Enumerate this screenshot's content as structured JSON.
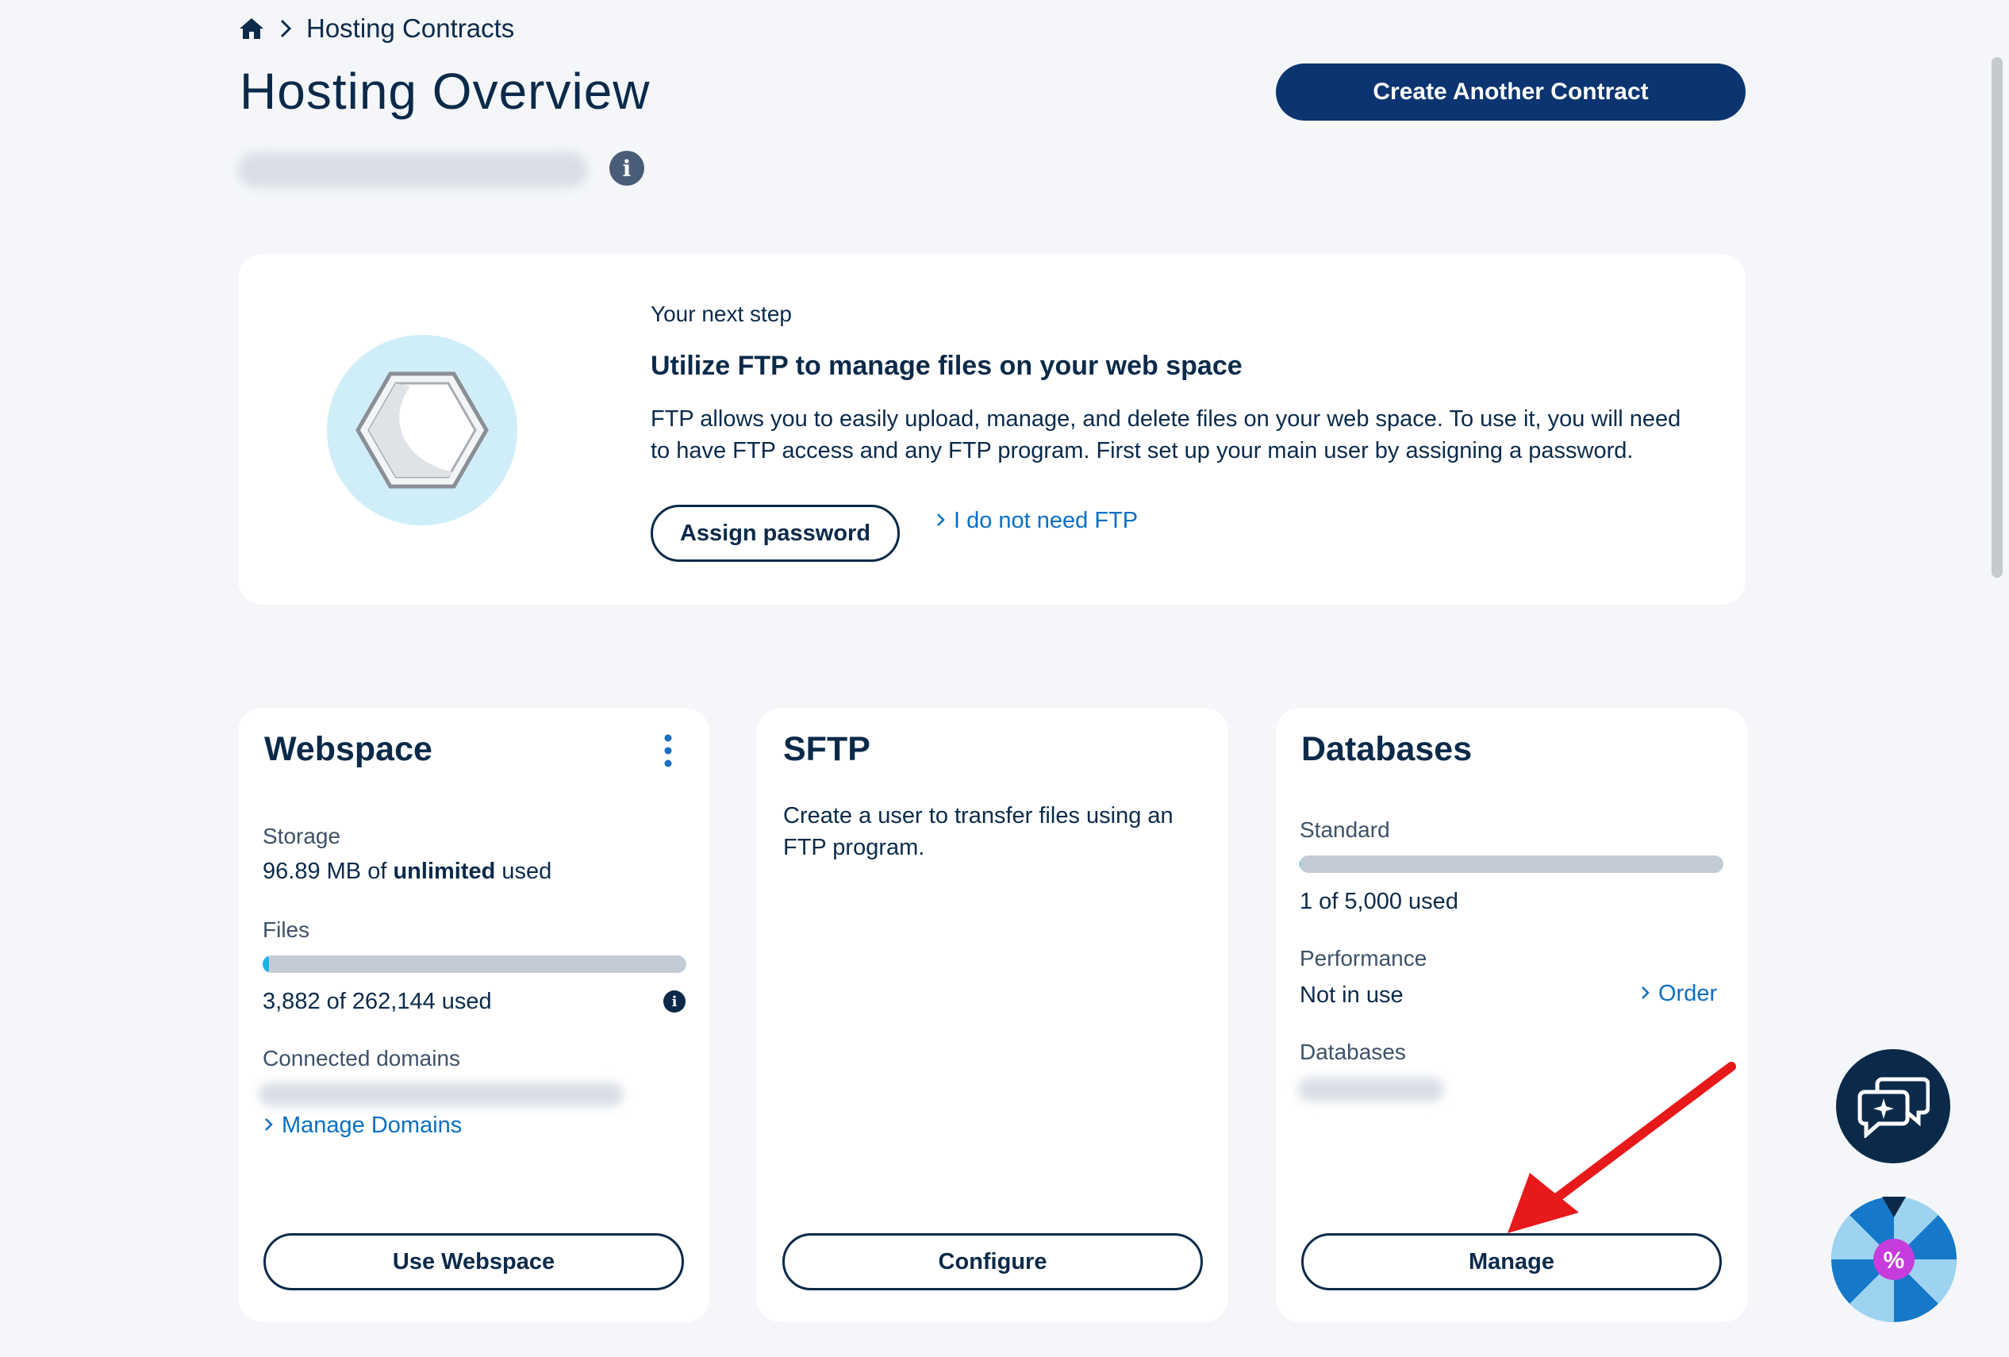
{
  "breadcrumb": {
    "home_icon": "home-icon",
    "separator_icon": "chevron-right-icon",
    "current": "Hosting Contracts"
  },
  "header": {
    "title": "Hosting Overview",
    "create_button": "Create Another Contract",
    "info_icon": "info-icon"
  },
  "next_step": {
    "kicker": "Your next step",
    "heading": "Utilize FTP to manage files on your web space",
    "body": "FTP allows you to easily upload, manage, and delete files on your web space. To use it, you will need to have FTP access and any FTP program. First set up your main user by assigning a password.",
    "primary_button": "Assign password",
    "secondary_link": "I do not need FTP",
    "illustration_icon": "hexagon-icon"
  },
  "webspace": {
    "title": "Webspace",
    "menu_icon": "kebab-menu-icon",
    "storage_label": "Storage",
    "storage_amount": "96.89 MB",
    "storage_of": " of ",
    "storage_limit": "unlimited",
    "storage_suffix": " used",
    "files_label": "Files",
    "files_value": "3,882 of 262,144 used",
    "files_fraction": 0.0148,
    "domains_label": "Connected domains",
    "manage_domains_link": "Manage Domains",
    "button": "Use Webspace"
  },
  "sftp": {
    "title": "SFTP",
    "description": "Create a user to transfer files using an FTP program.",
    "button": "Configure"
  },
  "databases": {
    "title": "Databases",
    "standard_label": "Standard",
    "standard_value": "1 of 5,000 used",
    "standard_fraction": 0.0002,
    "performance_label": "Performance",
    "performance_value": "Not in use",
    "order_link": "Order",
    "databases_label": "Databases",
    "button": "Manage"
  },
  "widgets": {
    "chat_icon": "chat-bubbles-icon",
    "promo_icon": "discount-wheel-icon"
  },
  "colors": {
    "primary": "#0b3470",
    "link": "#0a6fc2",
    "annotation_arrow": "#e8191a",
    "bar_fill": "#19b4e6"
  }
}
